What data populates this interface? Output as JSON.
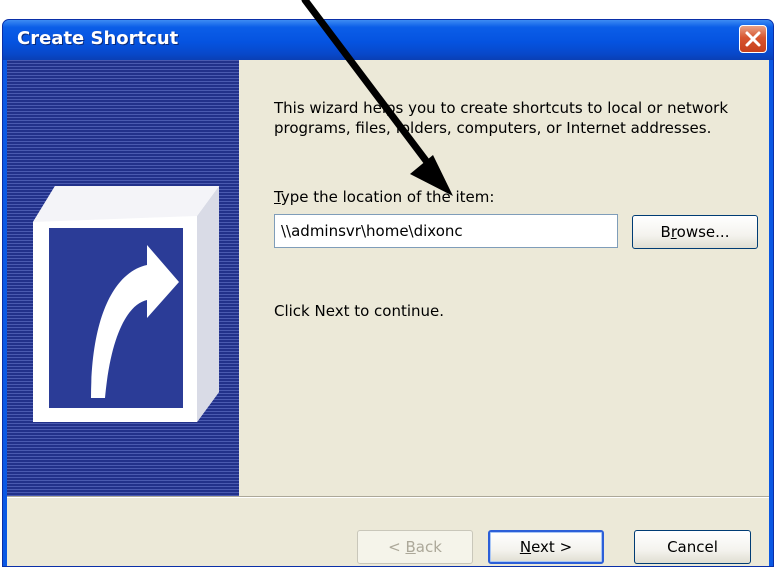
{
  "window": {
    "title": "Create Shortcut",
    "colors": {
      "title_bar": "#0553e0",
      "client_bg": "#ece9d8",
      "banner": "#2b3c97",
      "close_button": "#d7552f"
    }
  },
  "main": {
    "intro_text": "This wizard helps you to create shortcuts to local or network programs, files, folders, computers, or Internet addresses.",
    "location_label": {
      "accel": "T",
      "rest": "ype the location of the item:"
    },
    "location_value": "\\\\adminsvr\\home\\dixonc",
    "browse_button": {
      "pre": "B",
      "accel": "r",
      "post": "owse..."
    },
    "continue_text": "Click Next to continue."
  },
  "footer": {
    "back_button": {
      "pre": "< ",
      "accel": "B",
      "post": "ack",
      "enabled": false
    },
    "next_button": {
      "accel": "N",
      "post": "ext >"
    },
    "cancel_label": "Cancel"
  },
  "icons": {
    "banner": "shortcut-arrow-icon",
    "close": "close-icon",
    "annotation": "annotation-arrow-icon"
  }
}
